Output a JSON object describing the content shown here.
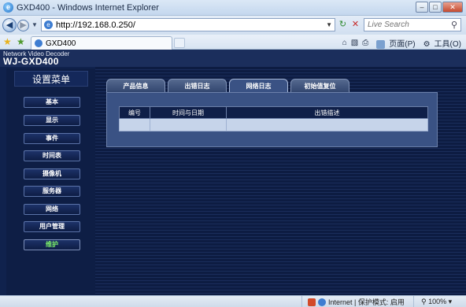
{
  "browser": {
    "window_title": "GXD400 - Windows Internet Explorer",
    "url": "http://192.168.0.250/",
    "search_placeholder": "Live Search",
    "tab_label": "GXD400",
    "commands": {
      "page_label": "页面(P)",
      "tools_label": "工具(O)"
    },
    "status": {
      "zone": "Internet | 保护模式: 启用",
      "zoom": "100%"
    }
  },
  "header": {
    "product_line": "Network Video Decoder",
    "model": "WJ-GXD400"
  },
  "sidebar": {
    "title": "设置菜单",
    "items": [
      {
        "label": "基本"
      },
      {
        "label": "显示"
      },
      {
        "label": "事件"
      },
      {
        "label": "时间表"
      },
      {
        "label": "摄像机"
      },
      {
        "label": "服务器"
      },
      {
        "label": "网络"
      },
      {
        "label": "用户管理"
      },
      {
        "label": "维护",
        "active": true
      }
    ]
  },
  "main": {
    "tabs": [
      {
        "label": "产品信息"
      },
      {
        "label": "出错日志"
      },
      {
        "label": "网络日志",
        "active": true
      },
      {
        "label": "初始值复位"
      }
    ],
    "table": {
      "headers": [
        "编号",
        "时间与日期",
        "出错描述"
      ],
      "rows": [
        [
          "",
          "",
          ""
        ]
      ]
    }
  },
  "colors": {
    "page_bg": "#10224d",
    "active_menu_text": "#7cf06a",
    "table_header_bg": "#0f1f48",
    "table_row_bg": "#c6d4ea"
  }
}
